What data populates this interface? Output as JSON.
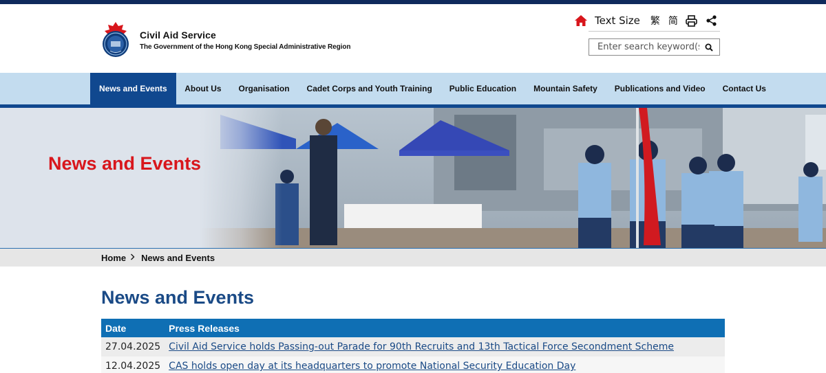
{
  "header": {
    "org_name": "Civil Aid Service",
    "org_subtitle": "The Government of the Hong Kong Special Administrative Region",
    "logo_icon": "cas-emblem-icon",
    "utility": {
      "home_icon": "home-icon",
      "text_size_label": "Text Size",
      "lang_traditional": "繁",
      "lang_simplified": "简",
      "print_icon": "print-icon",
      "share_icon": "share-icon"
    },
    "search": {
      "placeholder": "Enter search keyword(s)",
      "button_icon": "search-icon"
    }
  },
  "nav": {
    "items": [
      {
        "label": "News and Events",
        "active": true
      },
      {
        "label": "About Us",
        "active": false
      },
      {
        "label": "Organisation",
        "active": false
      },
      {
        "label": "Cadet Corps and Youth Training",
        "active": false
      },
      {
        "label": "Public Education",
        "active": false
      },
      {
        "label": "Mountain Safety",
        "active": false
      },
      {
        "label": "Publications and Video",
        "active": false
      },
      {
        "label": "Contact Us",
        "active": false
      }
    ]
  },
  "banner": {
    "title": "News and Events"
  },
  "breadcrumb": {
    "home": "Home",
    "separator_icon": "chevron-right-icon",
    "current": "News and Events"
  },
  "main": {
    "title": "News and Events",
    "table": {
      "headers": {
        "date": "Date",
        "press": "Press Releases"
      },
      "rows": [
        {
          "date": "27.04.2025",
          "title": "Civil Aid Service holds Passing-out Parade for 90th Recruits and 13th Tactical Force Secondment Scheme"
        },
        {
          "date": "12.04.2025",
          "title": "CAS holds open day at its headquarters to promote National Security Education Day"
        }
      ]
    }
  },
  "colors": {
    "brand_navy": "#0f2a5c",
    "nav_bg": "#c3dcef",
    "nav_active": "#10488f",
    "banner_title": "#d8161c",
    "page_title": "#1a4a86",
    "table_header": "#0f6fb4",
    "home_icon": "#d8161c"
  }
}
